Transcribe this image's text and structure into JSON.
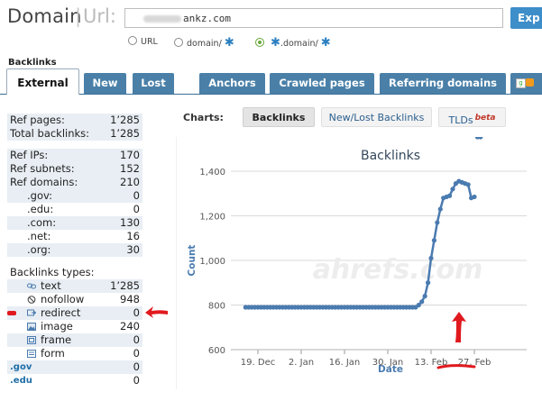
{
  "header": {
    "title_domain": "Domain",
    "title_sep": "|",
    "title_url": "Url:",
    "url_input_value_visible": "ankz.com",
    "explore_button": "Exp"
  },
  "radios": [
    {
      "label": "URL",
      "selected": false,
      "star": false
    },
    {
      "label": "domain/",
      "selected": false,
      "star": true
    },
    {
      "label": ".domain/",
      "selected": true,
      "star": true,
      "leading_star": true
    }
  ],
  "star_glyph": "✱",
  "section_label": "Backlinks",
  "tabs": [
    "External",
    "New",
    "Lost",
    "Anchors",
    "Crawled pages",
    "Referring domains"
  ],
  "left_panel": {
    "group1": [
      {
        "label": "Ref pages:",
        "value": "1’285"
      },
      {
        "label": "Total backlinks:",
        "value": "1’285"
      }
    ],
    "group2": [
      {
        "label": "Ref IPs:",
        "value": "170"
      },
      {
        "label": "Ref subnets:",
        "value": "152"
      },
      {
        "label": "Ref domains:",
        "value": "210"
      },
      {
        "label": ".gov:",
        "value": "0",
        "indent": true
      },
      {
        "label": ".edu:",
        "value": "0",
        "indent": true
      },
      {
        "label": ".com:",
        "value": "130",
        "indent": true
      },
      {
        "label": ".net:",
        "value": "16",
        "indent": true
      },
      {
        "label": ".org:",
        "value": "30",
        "indent": true
      }
    ],
    "types_heading": "Backlinks types:",
    "types": [
      {
        "label": "text",
        "value": "1’285",
        "icon": "text-link-icon"
      },
      {
        "label": "nofollow",
        "value": "948",
        "icon": "nofollow-icon"
      },
      {
        "label": "redirect",
        "value": "0",
        "icon": "redirect-icon"
      },
      {
        "label": "image",
        "value": "240",
        "icon": "image-icon"
      },
      {
        "label": "frame",
        "value": "0",
        "icon": "frame-icon"
      },
      {
        "label": "form",
        "value": "0",
        "icon": "form-icon"
      }
    ],
    "tld_links": [
      {
        "label": ".gov",
        "value": "0"
      },
      {
        "label": ".edu",
        "value": "0"
      }
    ]
  },
  "charts_bar": {
    "label": "Charts:",
    "buttons": [
      "Backlinks",
      "New/Lost Backlinks",
      "TLDs"
    ],
    "beta": "beta"
  },
  "colors": {
    "accent_blue": "#4a80a8",
    "line": "#4a7bb0",
    "annotation_red": "#e0191e"
  },
  "chart_data": {
    "type": "line",
    "title": "Backlinks",
    "xlabel": "Date",
    "ylabel": "Count",
    "ylim": [
      600,
      1400
    ],
    "yticks": [
      600,
      800,
      1000,
      1200,
      1400
    ],
    "ytick_labels": [
      "600",
      "800",
      "1,000",
      "1,200",
      "1,400"
    ],
    "xticks": [
      "19. Dec",
      "2. Jan",
      "16. Jan",
      "30. Jan",
      "13. Feb",
      "27. Feb"
    ],
    "xtick_day_offsets": [
      0,
      14,
      28,
      42,
      56,
      70
    ],
    "grid": true,
    "watermark": "ahrefs.com",
    "series": [
      {
        "day_offsets": [
          -4,
          -3,
          -2,
          -1,
          0,
          1,
          2,
          3,
          4,
          5,
          6,
          7,
          8,
          9,
          10,
          11,
          12,
          13,
          14,
          15,
          16,
          17,
          18,
          19,
          20,
          21,
          22,
          23,
          24,
          25,
          26,
          27,
          28,
          29,
          30,
          31,
          32,
          33,
          34,
          35,
          36,
          37,
          38,
          39,
          40,
          41,
          42,
          43,
          44,
          45,
          46,
          47,
          48,
          49,
          50,
          51,
          52,
          53,
          54,
          55,
          56,
          57,
          58,
          59,
          60,
          61,
          62,
          63,
          64,
          65,
          66,
          67,
          68,
          69,
          70,
          71,
          72
        ],
        "values": [
          790,
          790,
          790,
          790,
          790,
          790,
          790,
          790,
          790,
          790,
          790,
          790,
          790,
          790,
          790,
          790,
          790,
          790,
          790,
          790,
          790,
          790,
          790,
          790,
          790,
          790,
          790,
          790,
          790,
          790,
          790,
          790,
          790,
          790,
          790,
          790,
          790,
          790,
          790,
          790,
          790,
          790,
          790,
          790,
          790,
          790,
          790,
          790,
          790,
          790,
          790,
          790,
          790,
          790,
          790,
          790,
          800,
          815,
          840,
          900,
          1010,
          1090,
          1170,
          1230,
          1280,
          1285,
          1290,
          1320,
          1345,
          1355,
          1350,
          1345,
          1340,
          1280,
          1285
        ]
      }
    ]
  }
}
